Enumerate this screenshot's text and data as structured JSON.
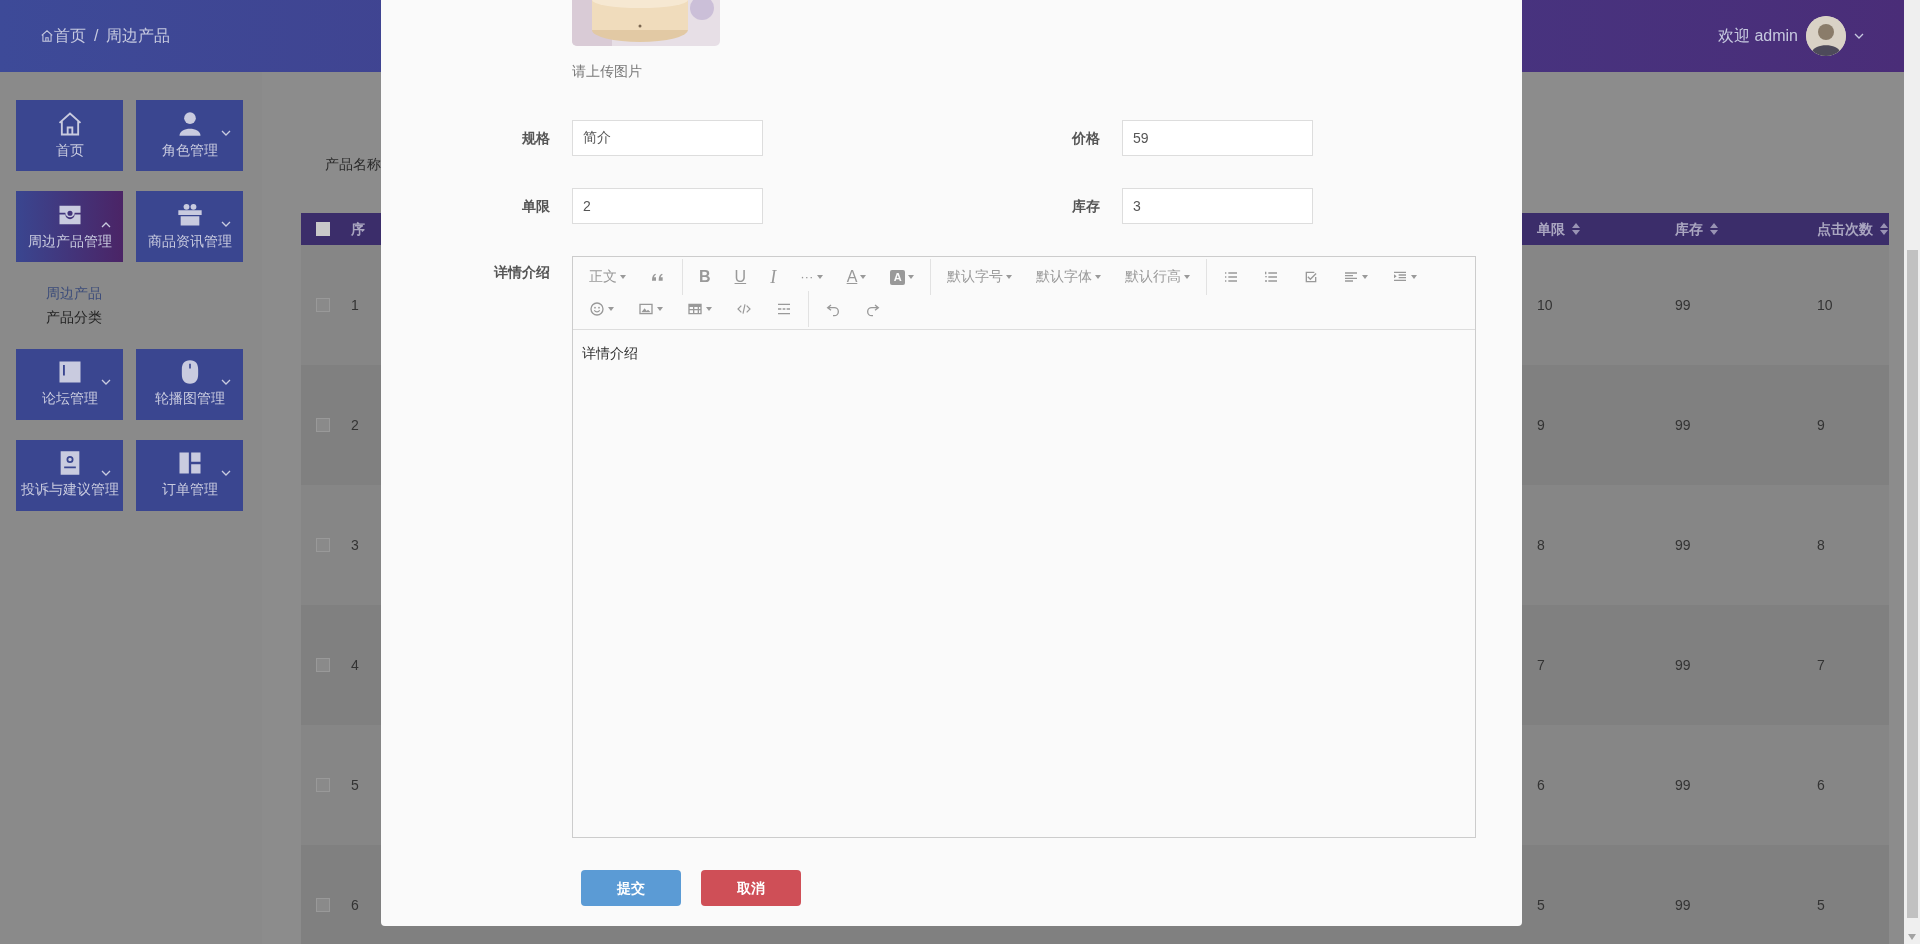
{
  "header": {
    "breadcrumb": [
      {
        "label": "首页"
      },
      {
        "label": "周边产品"
      }
    ],
    "separator": "/",
    "welcome": "欢迎 admin"
  },
  "sidebar": {
    "tiles": [
      {
        "label": "首页",
        "expandable": false,
        "selected": false
      },
      {
        "label": "角色管理",
        "expandable": true,
        "expanded": false,
        "selected": false
      },
      {
        "label": "周边产品管理",
        "expandable": true,
        "expanded": true,
        "selected": true,
        "children": [
          {
            "label": "周边产品",
            "selected": true
          },
          {
            "label": "产品分类",
            "selected": false
          }
        ]
      },
      {
        "label": "商品资讯管理",
        "expandable": true,
        "expanded": false,
        "selected": false
      },
      {
        "label": "论坛管理",
        "expandable": true,
        "expanded": false,
        "selected": false
      },
      {
        "label": "轮播图管理",
        "expandable": true,
        "expanded": false,
        "selected": false
      },
      {
        "label": "投诉与建议管理",
        "expandable": true,
        "expanded": false,
        "selected": false
      },
      {
        "label": "订单管理",
        "expandable": true,
        "expanded": false,
        "selected": false
      }
    ]
  },
  "search": {
    "label": "产品名称"
  },
  "table": {
    "select_all": {
      "checked": false
    },
    "columns": [
      "序",
      "单限",
      "库存",
      "点击次数"
    ],
    "rows": [
      {
        "checked": false,
        "cells": [
          "1",
          "10",
          "99",
          "10"
        ]
      },
      {
        "checked": false,
        "cells": [
          "2",
          "9",
          "99",
          "9"
        ]
      },
      {
        "checked": false,
        "cells": [
          "3",
          "8",
          "99",
          "8"
        ]
      },
      {
        "checked": false,
        "cells": [
          "4",
          "7",
          "99",
          "7"
        ]
      },
      {
        "checked": false,
        "cells": [
          "5",
          "6",
          "99",
          "6"
        ]
      },
      {
        "checked": false,
        "cells": [
          "6",
          "5",
          "99",
          "5"
        ]
      }
    ]
  },
  "modal": {
    "upload_hint": "请上传图片",
    "fields": [
      {
        "label": "规格",
        "value": "简介"
      },
      {
        "label": "价格",
        "value": "59"
      },
      {
        "label": "单限",
        "value": "2"
      },
      {
        "label": "库存",
        "value": "3"
      }
    ],
    "editor": {
      "label": "详情介绍",
      "content": "详情介绍",
      "toolbar": [
        [
          {
            "kind": "text",
            "label": "正文",
            "caret": true
          },
          {
            "kind": "icon",
            "caret": false
          },
          {
            "kind": "divider"
          },
          {
            "kind": "bold",
            "label": "B",
            "caret": false
          },
          {
            "kind": "underline",
            "label": "U",
            "caret": false
          },
          {
            "kind": "italic",
            "label": "I",
            "caret": false
          },
          {
            "kind": "text",
            "label": "···",
            "caret": true
          },
          {
            "kind": "color",
            "label": "A",
            "caret": true
          },
          {
            "kind": "bgcolor",
            "label": "A",
            "caret": true
          },
          {
            "kind": "divider"
          },
          {
            "kind": "text",
            "label": "默认字号",
            "caret": true
          },
          {
            "kind": "text",
            "label": "默认字体",
            "caret": true
          },
          {
            "kind": "text",
            "label": "默认行高",
            "caret": true
          },
          {
            "kind": "divider"
          },
          {
            "kind": "icon",
            "caret": false
          },
          {
            "kind": "icon",
            "caret": false
          },
          {
            "kind": "icon",
            "caret": false
          },
          {
            "kind": "icon",
            "caret": true
          },
          {
            "kind": "icon",
            "caret": true
          }
        ],
        [
          {
            "kind": "icon",
            "caret": true
          },
          {
            "kind": "icon",
            "caret": true
          },
          {
            "kind": "icon",
            "caret": true
          },
          {
            "kind": "icon",
            "caret": false
          },
          {
            "kind": "icon",
            "caret": false
          },
          {
            "kind": "divider"
          },
          {
            "kind": "icon",
            "caret": false
          },
          {
            "kind": "icon",
            "caret": false
          }
        ]
      ]
    },
    "buttons": [
      {
        "label": "提交",
        "kind": "primary"
      },
      {
        "label": "取消",
        "kind": "danger"
      }
    ]
  }
}
